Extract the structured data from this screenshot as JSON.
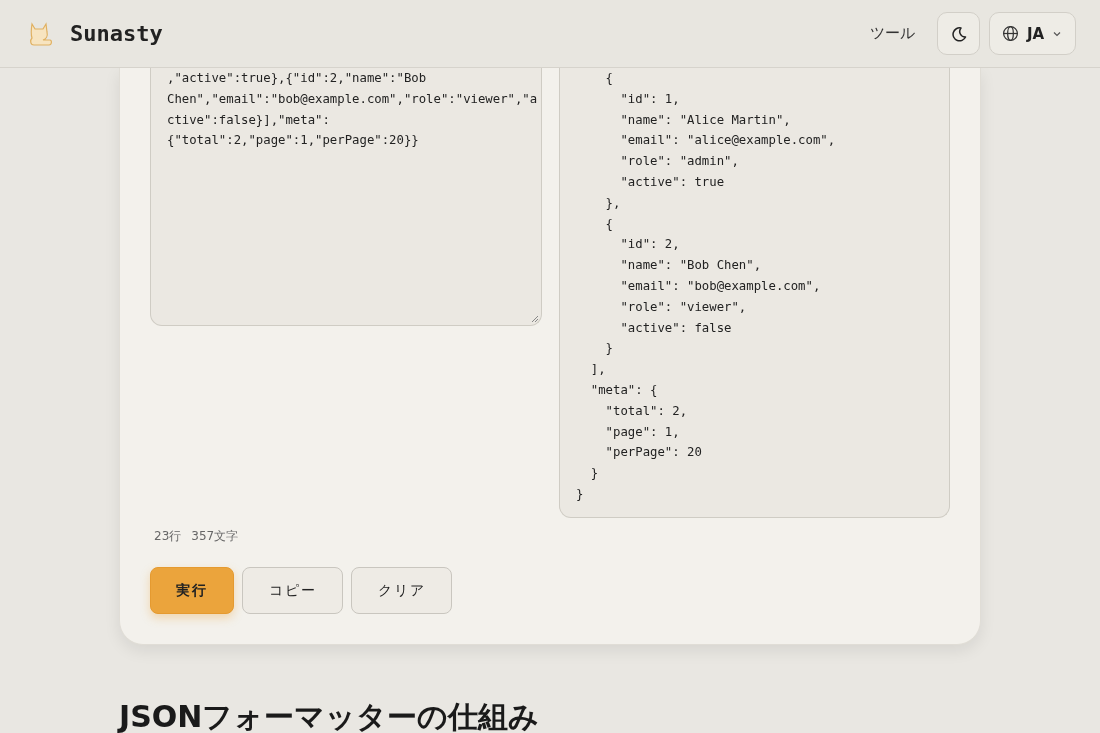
{
  "header": {
    "brand": "Sunasty",
    "nav_link": "ツール",
    "language": "JA"
  },
  "input": {
    "lines": [
      ",\"active\":true},{\"id\":2,\"name\":\"Bob",
      "Chen\",\"email\":\"bob@example.com\",\"role\":\"viewer\",\"a",
      "ctive\":false}],\"meta\":",
      "{\"total\":2,\"page\":1,\"perPage\":20}}"
    ]
  },
  "output": {
    "lines": [
      "    {",
      "      \"id\": 1,",
      "      \"name\": \"Alice Martin\",",
      "      \"email\": \"alice@example.com\",",
      "      \"role\": \"admin\",",
      "      \"active\": true",
      "    },",
      "    {",
      "      \"id\": 2,",
      "      \"name\": \"Bob Chen\",",
      "      \"email\": \"bob@example.com\",",
      "      \"role\": \"viewer\",",
      "      \"active\": false",
      "    }",
      "  ],",
      "  \"meta\": {",
      "    \"total\": 2,",
      "    \"page\": 1,",
      "    \"perPage\": 20",
      "  }",
      "}"
    ]
  },
  "stats": {
    "lines": "23行",
    "chars": "357文字"
  },
  "buttons": [
    {
      "label": "実行",
      "kind": "primary"
    },
    {
      "label": "コピー",
      "kind": "secondary"
    },
    {
      "label": "クリア",
      "kind": "secondary"
    }
  ],
  "section_heading": "JSONフォーマッターの仕組み"
}
